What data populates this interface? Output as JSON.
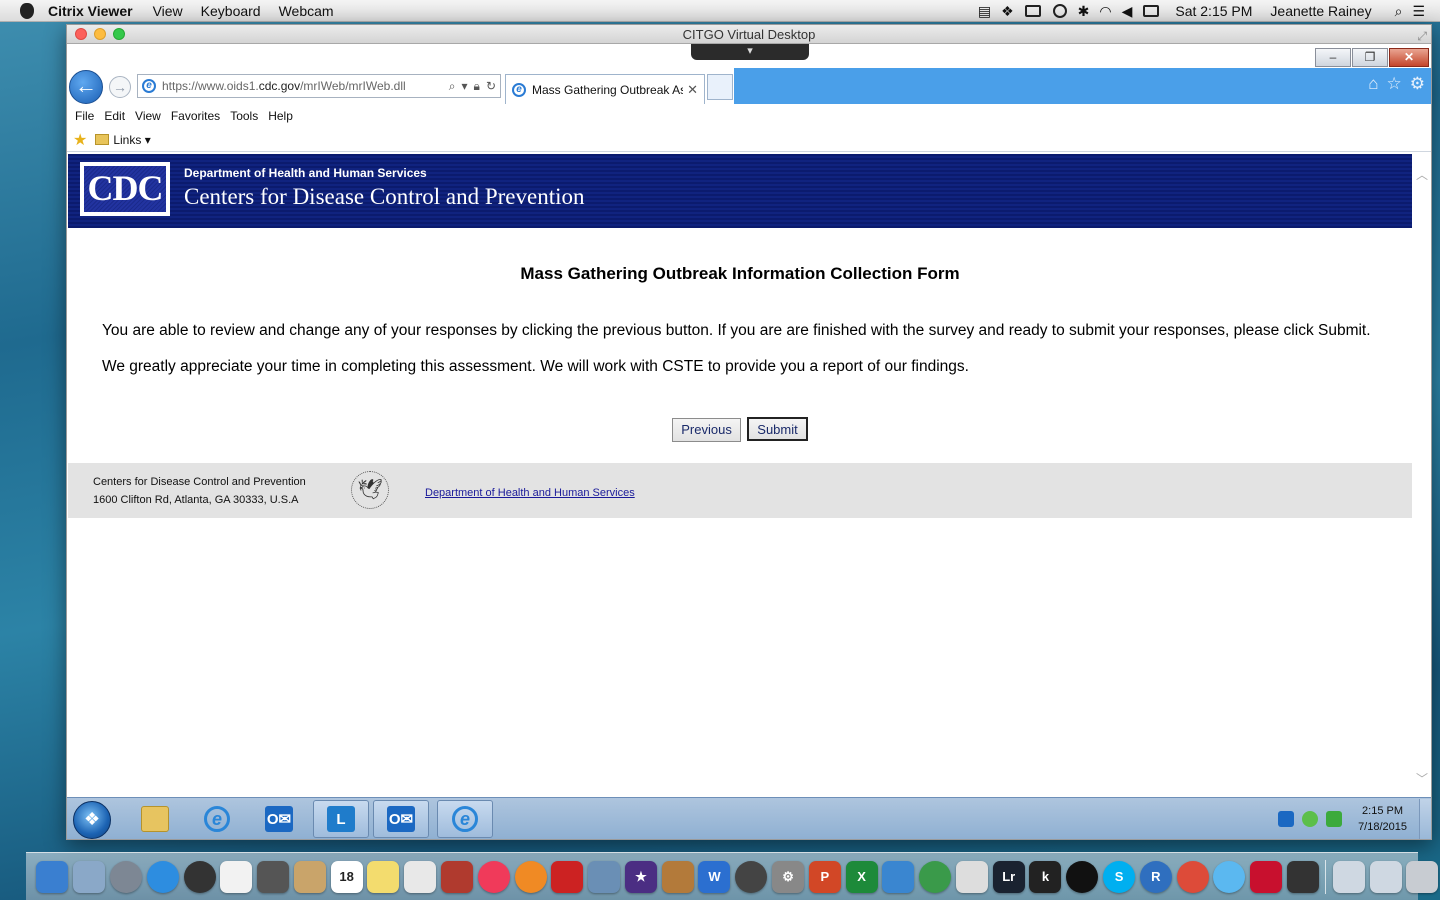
{
  "mac_menubar": {
    "app_name": "Citrix Viewer",
    "menus": [
      "View",
      "Keyboard",
      "Webcam"
    ],
    "clock": "Sat 2:15 PM",
    "user": "Jeanette Rainey"
  },
  "citrix_window": {
    "title": "CITGO Virtual Desktop"
  },
  "browser": {
    "url_prefix": "https://www.oids1.",
    "url_domain": "cdc.gov",
    "url_path": "/mrIWeb/mrIWeb.dll",
    "tab_title": "Mass Gathering Outbreak Ass...",
    "menu": [
      "File",
      "Edit",
      "View",
      "Favorites",
      "Tools",
      "Help"
    ],
    "links_label": "Links"
  },
  "cdc_header": {
    "logo_text": "CDC",
    "department": "Department of Health and Human Services",
    "title": "Centers for Disease Control and Prevention"
  },
  "form": {
    "title": "Mass Gathering Outbreak Information Collection Form",
    "paragraph1": "You are able to review and change any of your responses by clicking the previous button. If you are are finished with the survey and ready to submit your responses, please click Submit.",
    "paragraph2": "We greatly appreciate your time in completing this assessment. We will work with CSTE to provide you a report of our findings.",
    "previous_label": "Previous",
    "submit_label": "Submit"
  },
  "footer": {
    "org": "Centers for Disease Control and Prevention",
    "address": "1600 Clifton Rd, Atlanta, GA 30333, U.S.A",
    "hhs_link": "Department of Health and Human Services"
  },
  "win_taskbar": {
    "time": "2:15 PM",
    "date": "7/18/2015"
  },
  "dock_apps": [
    "finder",
    "preview",
    "launchpad",
    "safari",
    "dashboard",
    "textedit",
    "facetime",
    "contacts",
    "calendar",
    "notes",
    "reminders",
    "photo-booth",
    "itunes",
    "ibooks",
    "photo-slideshow",
    "iphoto",
    "imovie",
    "garageband",
    "word",
    "time-machine",
    "system-preferences",
    "powerpoint",
    "excel",
    "lync",
    "network",
    "printer",
    "lightroom",
    "kindle",
    "aperture",
    "skype",
    "r",
    "chrome",
    "messages",
    "acrobat",
    "citrix",
    "downloads",
    "documents",
    "trash"
  ],
  "colors": {
    "cdc_navy": "#0b1b6e",
    "footer_gray": "#e3e3e3",
    "ie_blue": "#4a9fe9"
  }
}
